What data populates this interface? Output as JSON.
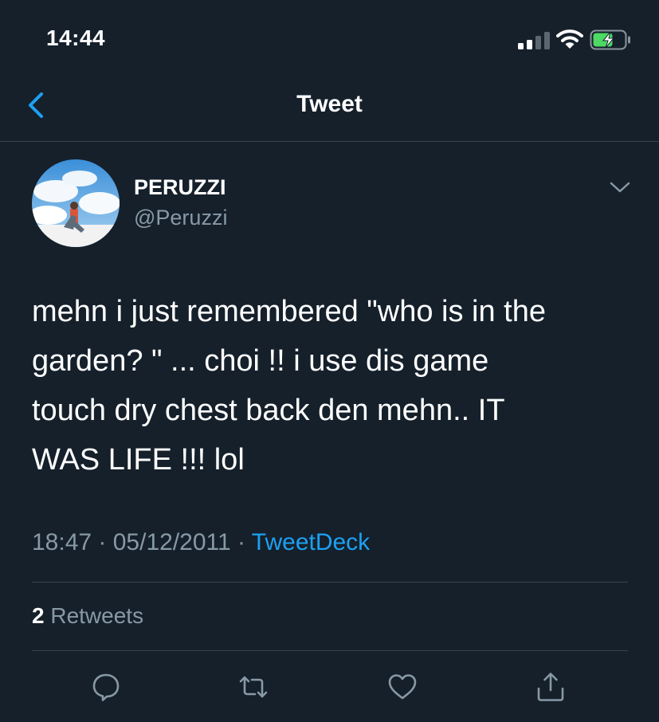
{
  "status_bar": {
    "time": "14:44"
  },
  "nav": {
    "title": "Tweet"
  },
  "author": {
    "name": "PERUZZI",
    "handle": "@Peruzzi"
  },
  "tweet": {
    "lines": [
      "mehn i just remembered \"who is in the",
      "garden? \" ... choi !! i use dis game",
      "touch dry chest back den mehn.. IT",
      "WAS LIFE !!! lol"
    ]
  },
  "meta": {
    "time": "18:47",
    "separator": " · ",
    "date": "05/12/2011",
    "source": "TweetDeck"
  },
  "stats": {
    "retweet_count": "2",
    "retweet_label": "Retweets"
  },
  "actions": [
    "reply-icon",
    "retweet-icon",
    "like-icon",
    "share-icon"
  ],
  "colors": {
    "background": "#15202b",
    "accent": "#1da1f2",
    "muted": "#8899a6",
    "battery": "#4cd964"
  }
}
